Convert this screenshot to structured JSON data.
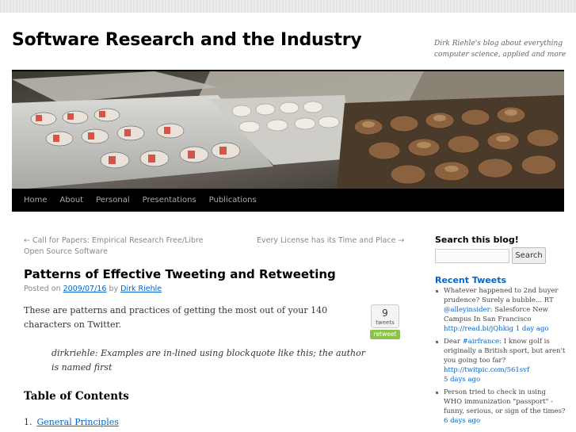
{
  "site": {
    "title": "Software Research and the Industry",
    "description": "Dirk Riehle's blog about everything computer science, applied and more"
  },
  "menu": [
    {
      "label": "Home"
    },
    {
      "label": "About"
    },
    {
      "label": "Personal"
    },
    {
      "label": "Presentations"
    },
    {
      "label": "Publications"
    }
  ],
  "nav": {
    "prev": "← Call for Papers: Empirical Research Free/Libre Open Source Software",
    "next": "Every License has its Time and Place →"
  },
  "post": {
    "title": "Patterns of Effective Tweeting and Retweeting",
    "posted_on_label": "Posted on",
    "date": "2009/07/16",
    "by_label": "by",
    "author": "Dirk Riehle",
    "intro": "These are patterns and practices of getting the most out of your 140 characters on Twitter.",
    "blockquote": "dirkriehle: Examples are in-lined using blockquote like this; the author is named first",
    "toc_heading": "Table of Contents",
    "toc": [
      {
        "num": "1.",
        "label": "General Principles"
      }
    ]
  },
  "tweetmeme": {
    "count": "9",
    "unit": "tweets",
    "button": "retweet"
  },
  "sidebar": {
    "search_title": "Search this blog!",
    "search_value": "",
    "search_button": "Search",
    "tweets_title": "Recent Tweets",
    "tweets": [
      {
        "pre": "Whatever happened to 2nd buyer prudence? Surely a bubble... RT ",
        "mention": "@alleyinsider",
        "post": ": Salesforce New Campus In San Francisco ",
        "link": "http://read.bi/jQhkig",
        "time": "1 day ago"
      },
      {
        "pre": "Dear ",
        "mention": "#airfrance",
        "post": ": I know golf is originally a British sport, but aren't you going too far? ",
        "link": "http://twitpic.com/561svf",
        "time": "5 days ago"
      },
      {
        "pre": "Person tried to check in using WHO immunization \"passport\" - funny, serious, or sign of the times?",
        "mention": "",
        "post": "",
        "link": "",
        "time": "6 days ago"
      }
    ]
  },
  "colors": {
    "link": "#0066cc",
    "menu_bg": "#000000",
    "retweet_green": "#8bc34a"
  }
}
